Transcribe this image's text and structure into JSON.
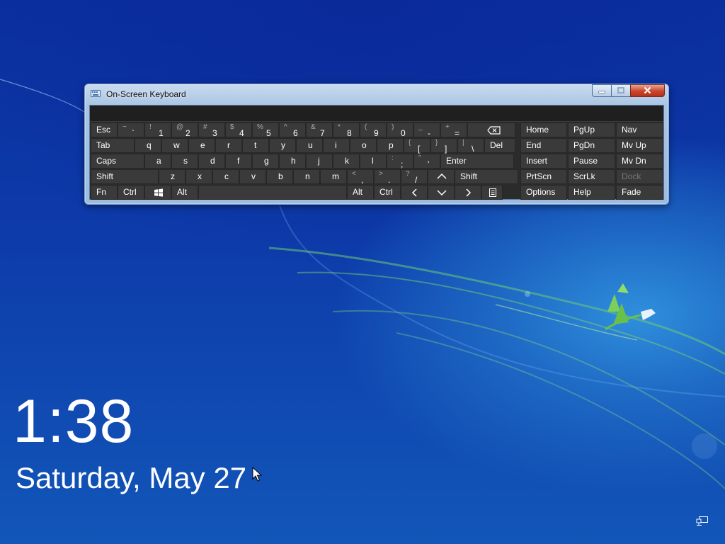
{
  "window": {
    "title": "On-Screen Keyboard"
  },
  "keyboard": {
    "row1": [
      {
        "main": "Esc"
      },
      {
        "shift": "~",
        "main": "`"
      },
      {
        "shift": "!",
        "main": "1"
      },
      {
        "shift": "@",
        "main": "2"
      },
      {
        "shift": "#",
        "main": "3"
      },
      {
        "shift": "$",
        "main": "4"
      },
      {
        "shift": "%",
        "main": "5"
      },
      {
        "shift": "^",
        "main": "6"
      },
      {
        "shift": "&",
        "main": "7"
      },
      {
        "shift": "*",
        "main": "8"
      },
      {
        "shift": "(",
        "main": "9"
      },
      {
        "shift": ")",
        "main": "0"
      },
      {
        "shift": "_",
        "main": "-"
      },
      {
        "shift": "+",
        "main": "="
      },
      {
        "icon": "backspace-icon"
      }
    ],
    "row2": [
      {
        "main": "Tab"
      },
      {
        "main": "q"
      },
      {
        "main": "w"
      },
      {
        "main": "e"
      },
      {
        "main": "r"
      },
      {
        "main": "t"
      },
      {
        "main": "y"
      },
      {
        "main": "u"
      },
      {
        "main": "i"
      },
      {
        "main": "o"
      },
      {
        "main": "p"
      },
      {
        "shift": "{",
        "main": "["
      },
      {
        "shift": "}",
        "main": "]"
      },
      {
        "shift": "|",
        "main": "\\"
      },
      {
        "main": "Del"
      }
    ],
    "row3": [
      {
        "main": "Caps"
      },
      {
        "main": "a"
      },
      {
        "main": "s"
      },
      {
        "main": "d"
      },
      {
        "main": "f"
      },
      {
        "main": "g"
      },
      {
        "main": "h"
      },
      {
        "main": "j"
      },
      {
        "main": "k"
      },
      {
        "main": "l"
      },
      {
        "shift": ":",
        "main": ";"
      },
      {
        "shift": "\"",
        "main": "'"
      },
      {
        "main": "Enter"
      }
    ],
    "row4": [
      {
        "main": "Shift"
      },
      {
        "main": "z"
      },
      {
        "main": "x"
      },
      {
        "main": "c"
      },
      {
        "main": "v"
      },
      {
        "main": "b"
      },
      {
        "main": "n"
      },
      {
        "main": "m"
      },
      {
        "shift": "<",
        "main": ","
      },
      {
        "shift": ">",
        "main": "."
      },
      {
        "shift": "?",
        "main": "/"
      },
      {
        "icon": "arrow-up-icon"
      },
      {
        "main": "Shift"
      }
    ],
    "row5": [
      {
        "main": "Fn"
      },
      {
        "main": "Ctrl"
      },
      {
        "icon": "windows-icon"
      },
      {
        "main": "Alt"
      },
      {
        "main": ""
      },
      {
        "main": "Alt"
      },
      {
        "main": "Ctrl"
      },
      {
        "icon": "arrow-left-icon"
      },
      {
        "icon": "arrow-down-icon"
      },
      {
        "icon": "arrow-right-icon"
      },
      {
        "icon": "context-menu-icon"
      }
    ],
    "nav": [
      [
        "Home",
        "PgUp",
        "Nav"
      ],
      [
        "End",
        "PgDn",
        "Mv Up"
      ],
      [
        "Insert",
        "Pause",
        "Mv Dn"
      ],
      [
        "PrtScn",
        "ScrLk",
        "Dock"
      ],
      [
        "Options",
        "Help",
        "Fade"
      ]
    ],
    "disabled": [
      "Dock"
    ]
  },
  "lockscreen": {
    "time": "1:38",
    "date": "Saturday, May 27"
  },
  "colors": {
    "key_bg": "#3a3a3a",
    "key_text": "#ffffff",
    "key_shift_text": "#a8a8a8",
    "client_bg": "#2b2b2b"
  }
}
